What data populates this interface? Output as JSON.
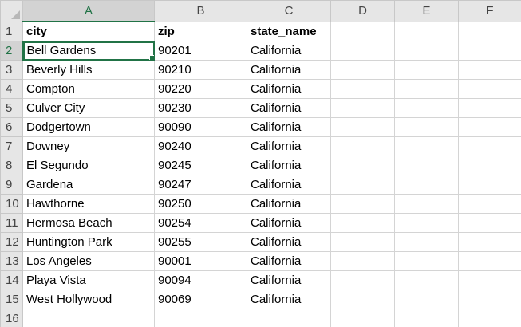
{
  "columns": [
    "A",
    "B",
    "C",
    "D",
    "E",
    "F"
  ],
  "active_cell": {
    "column": "A",
    "row": 2
  },
  "rows": [
    {
      "num": "1",
      "cells": [
        "city",
        "zip",
        "state_name",
        "",
        "",
        ""
      ]
    },
    {
      "num": "2",
      "cells": [
        "Bell Gardens",
        "90201",
        "California",
        "",
        "",
        ""
      ]
    },
    {
      "num": "3",
      "cells": [
        "Beverly Hills",
        "90210",
        "California",
        "",
        "",
        ""
      ]
    },
    {
      "num": "4",
      "cells": [
        "Compton",
        "90220",
        "California",
        "",
        "",
        ""
      ]
    },
    {
      "num": "5",
      "cells": [
        "Culver City",
        "90230",
        "California",
        "",
        "",
        ""
      ]
    },
    {
      "num": "6",
      "cells": [
        "Dodgertown",
        "90090",
        "California",
        "",
        "",
        ""
      ]
    },
    {
      "num": "7",
      "cells": [
        "Downey",
        "90240",
        "California",
        "",
        "",
        ""
      ]
    },
    {
      "num": "8",
      "cells": [
        "El Segundo",
        "90245",
        "California",
        "",
        "",
        ""
      ]
    },
    {
      "num": "9",
      "cells": [
        "Gardena",
        "90247",
        "California",
        "",
        "",
        ""
      ]
    },
    {
      "num": "10",
      "cells": [
        "Hawthorne",
        "90250",
        "California",
        "",
        "",
        ""
      ]
    },
    {
      "num": "11",
      "cells": [
        "Hermosa Beach",
        "90254",
        "California",
        "",
        "",
        ""
      ]
    },
    {
      "num": "12",
      "cells": [
        "Huntington Park",
        "90255",
        "California",
        "",
        "",
        ""
      ]
    },
    {
      "num": "13",
      "cells": [
        "Los Angeles",
        "90001",
        "California",
        "",
        "",
        ""
      ]
    },
    {
      "num": "14",
      "cells": [
        "Playa Vista",
        "90094",
        "California",
        "",
        "",
        ""
      ]
    },
    {
      "num": "15",
      "cells": [
        "West Hollywood",
        "90069",
        "California",
        "",
        "",
        ""
      ]
    },
    {
      "num": "16",
      "cells": [
        "",
        "",
        "",
        "",
        "",
        ""
      ]
    }
  ]
}
